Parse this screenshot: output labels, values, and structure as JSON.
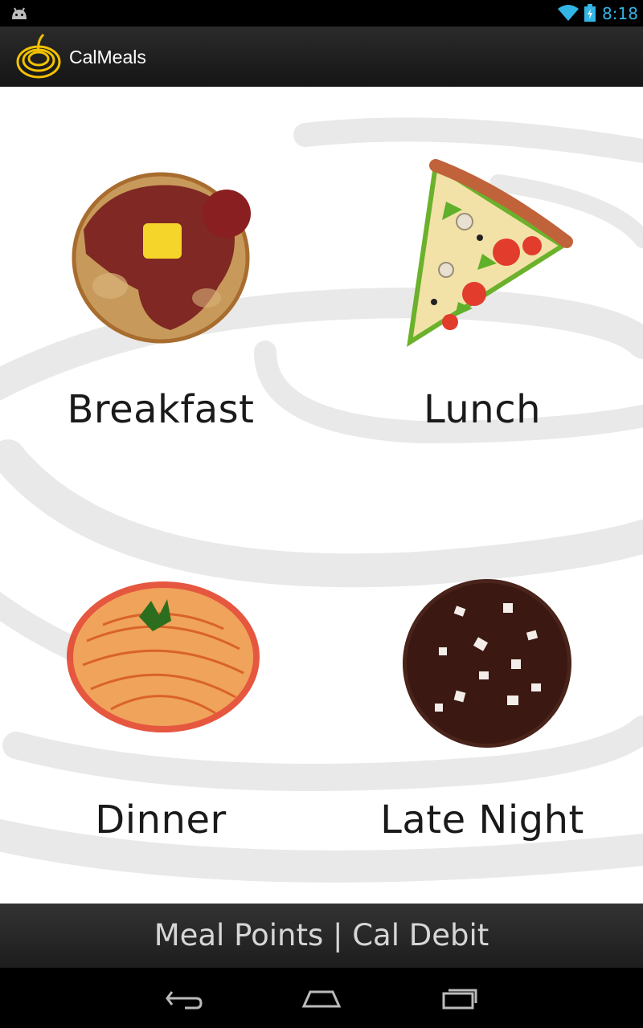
{
  "status_bar": {
    "time": "8:18",
    "icons": [
      "android-debug-icon",
      "wifi-icon",
      "battery-charging-icon"
    ],
    "accent_color": "#33b5e5"
  },
  "action_bar": {
    "title": "CalMeals",
    "icon": "calmeals-logo-icon"
  },
  "meals": [
    {
      "label": "Breakfast",
      "icon": "pancakes-icon"
    },
    {
      "label": "Lunch",
      "icon": "pizza-slice-icon"
    },
    {
      "label": "Dinner",
      "icon": "spaghetti-icon"
    },
    {
      "label": "Late Night",
      "icon": "cookie-icon"
    }
  ],
  "footer": {
    "meal_points_label": "Meal Points | Cal Debit"
  },
  "nav_bar": {
    "buttons": [
      "back-icon",
      "home-icon",
      "recent-apps-icon"
    ]
  }
}
